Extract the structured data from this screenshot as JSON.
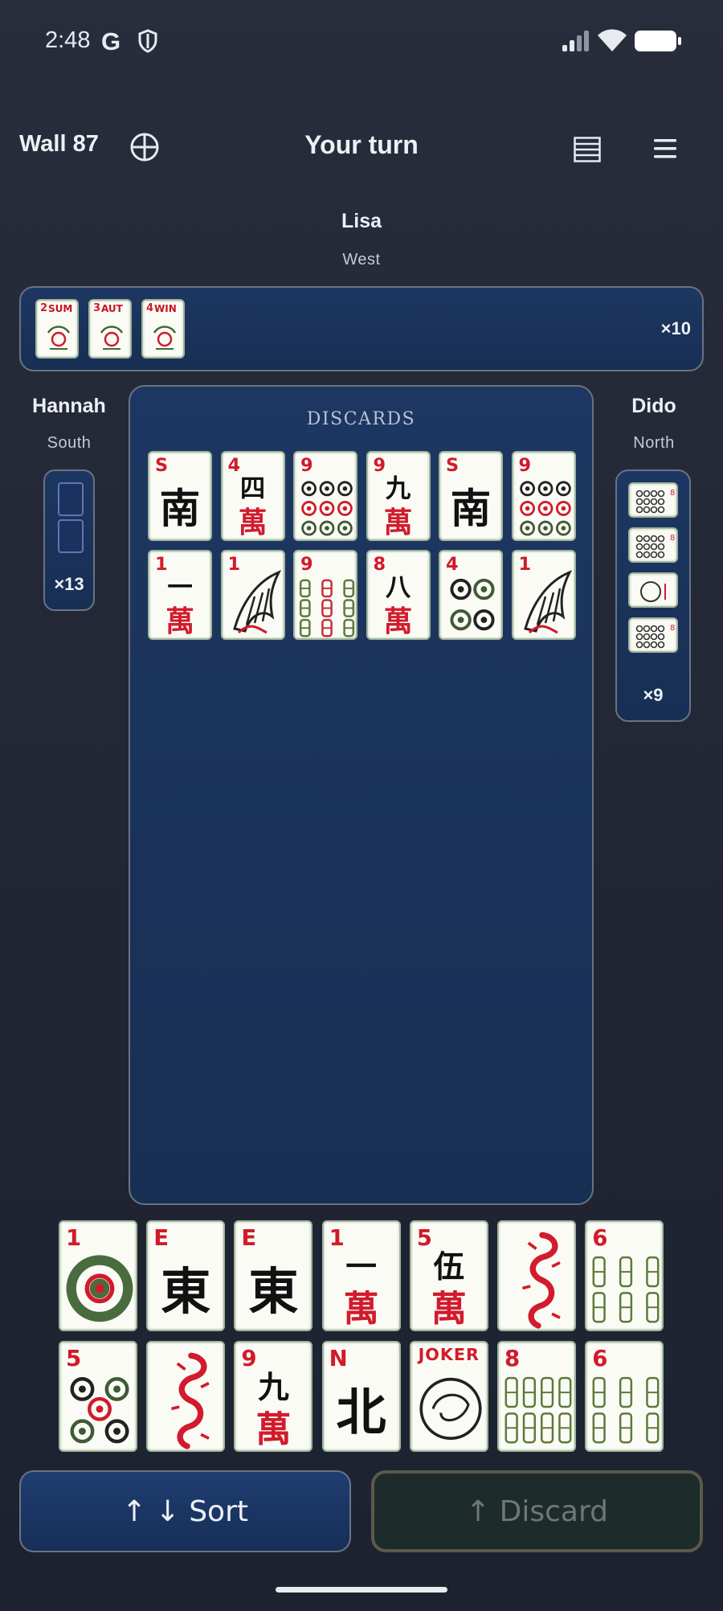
{
  "status_bar": {
    "time": "2:48",
    "g_letter": "G"
  },
  "header": {
    "wall_label": "Wall 87",
    "turn_label": "Your turn"
  },
  "players": {
    "top": {
      "name": "Lisa",
      "wind": "West",
      "count": "×10",
      "exposed": [
        {
          "num": "2",
          "label": "SUM"
        },
        {
          "num": "3",
          "label": "AUT"
        },
        {
          "num": "4",
          "label": "WIN"
        }
      ]
    },
    "left": {
      "name": "Hannah",
      "wind": "South",
      "count": "×13"
    },
    "right": {
      "name": "Dido",
      "wind": "North",
      "count": "×9"
    }
  },
  "discards": {
    "title": "DISCARDS",
    "rows": [
      [
        {
          "num": "S",
          "glyph": "南",
          "kind": "wind"
        },
        {
          "num": "4",
          "glyph": "四",
          "wan": "萬",
          "kind": "char"
        },
        {
          "num": "9",
          "kind": "dots"
        },
        {
          "num": "9",
          "glyph": "九",
          "wan": "萬",
          "kind": "char"
        },
        {
          "num": "S",
          "glyph": "南",
          "kind": "wind"
        },
        {
          "num": "9",
          "kind": "dots"
        }
      ],
      [
        {
          "num": "1",
          "glyph": "一",
          "wan": "萬",
          "kind": "char"
        },
        {
          "num": "1",
          "kind": "bird"
        },
        {
          "num": "9",
          "kind": "bam"
        },
        {
          "num": "8",
          "glyph": "八",
          "wan": "萬",
          "kind": "char"
        },
        {
          "num": "4",
          "kind": "dots"
        },
        {
          "num": "1",
          "kind": "bird"
        }
      ]
    ]
  },
  "hand": {
    "rows": [
      [
        {
          "num": "1",
          "kind": "dots"
        },
        {
          "num": "E",
          "glyph": "東",
          "kind": "wind"
        },
        {
          "num": "E",
          "glyph": "東",
          "kind": "wind"
        },
        {
          "num": "1",
          "glyph": "一",
          "wan": "萬",
          "kind": "char"
        },
        {
          "num": "5",
          "glyph": "伍",
          "wan": "萬",
          "kind": "char"
        },
        {
          "num": "",
          "kind": "dragon"
        },
        {
          "num": "6",
          "kind": "bam"
        }
      ],
      [
        {
          "num": "5",
          "kind": "dots"
        },
        {
          "num": "",
          "kind": "dragon"
        },
        {
          "num": "9",
          "glyph": "九",
          "wan": "萬",
          "kind": "char"
        },
        {
          "num": "N",
          "glyph": "北",
          "kind": "wind"
        },
        {
          "num": "JOKER",
          "kind": "joker"
        },
        {
          "num": "8",
          "kind": "bam"
        },
        {
          "num": "6",
          "kind": "bam"
        }
      ]
    ]
  },
  "buttons": {
    "sort_label": "↑ ↓  Sort",
    "discard_label": "↑  Discard"
  }
}
